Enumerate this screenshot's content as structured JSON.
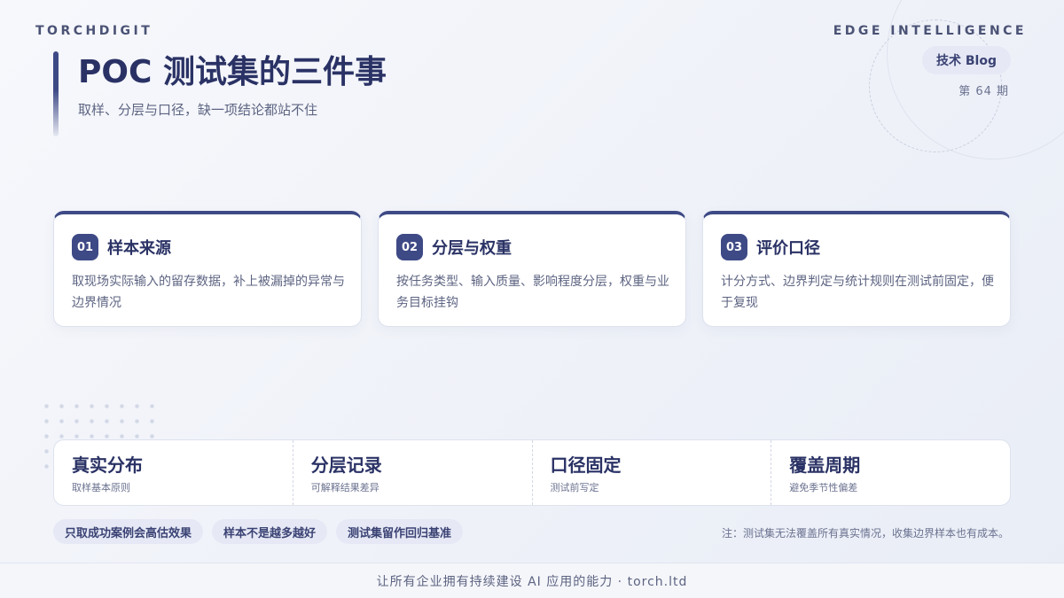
{
  "header": {
    "brand_left": "TORCHDIGIT",
    "brand_right": "EDGE INTELLIGENCE",
    "blog_pill": "技术 Blog",
    "issue": "第 64 期"
  },
  "hero": {
    "title": "POC 测试集的三件事",
    "subtitle": "取样、分层与口径，缺一项结论都站不住"
  },
  "cards": [
    {
      "num": "01",
      "title": "样本来源",
      "desc": "取现场实际输入的留存数据，补上被漏掉的异常与边界情况"
    },
    {
      "num": "02",
      "title": "分层与权重",
      "desc": "按任务类型、输入质量、影响程度分层，权重与业务目标挂钩"
    },
    {
      "num": "03",
      "title": "评价口径",
      "desc": "计分方式、边界判定与统计规则在测试前固定，便于复现"
    }
  ],
  "stats": [
    {
      "value": "真实分布",
      "label": "取样基本原则"
    },
    {
      "value": "分层记录",
      "label": "可解释结果差异"
    },
    {
      "value": "口径固定",
      "label": "测试前写定"
    },
    {
      "value": "覆盖周期",
      "label": "避免季节性偏差"
    }
  ],
  "tags": [
    "只取成功案例会高估效果",
    "样本不是越多越好",
    "测试集留作回归基准"
  ],
  "note": "注：测试集无法覆盖所有真实情况，收集边界样本也有成本。",
  "footer": "让所有企业拥有持续建设 AI 应用的能力 · torch.ltd",
  "colors": {
    "accent": "#3e4a86",
    "title": "#2a3265",
    "background": "#eef1f8"
  }
}
